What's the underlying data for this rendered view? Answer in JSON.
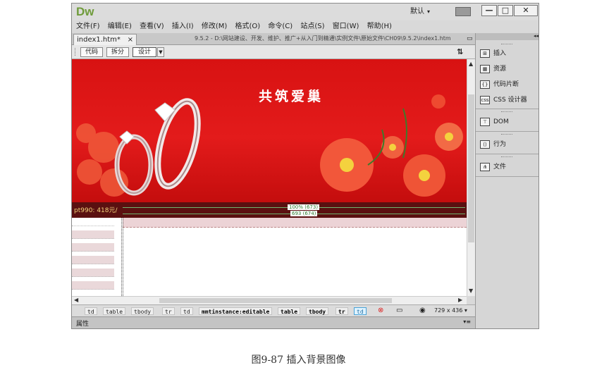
{
  "app": {
    "logo": "Dw",
    "workspace": "默认",
    "workspace_arrow": "▾"
  },
  "window_controls": {
    "minimize": "—",
    "maximize": "□",
    "close": "✕"
  },
  "menu": [
    "文件(F)",
    "编辑(E)",
    "查看(V)",
    "插入(I)",
    "修改(M)",
    "格式(O)",
    "命令(C)",
    "站点(S)",
    "窗口(W)",
    "帮助(H)"
  ],
  "document": {
    "tab": "index1.htm*",
    "tab_close": "×",
    "path": "9.5.2 - D:\\网站建设、开发、维护、推广+从入门到精通\\实例文件\\原始文件\\CH09\\9.5.2\\index1.htm"
  },
  "view_buttons": {
    "code": "代码",
    "split": "拆分",
    "design": "设计"
  },
  "canvas": {
    "banner_title": "共筑爱巢",
    "price_text": "pt990: 418元/",
    "guide_top": "100% (673)",
    "guide_bottom": "693 (674)"
  },
  "tag_selector": [
    "td",
    "table",
    "tbody",
    "tr",
    "td",
    "mmtinstance:editable",
    "table",
    "tbody",
    "tr",
    "td"
  ],
  "status": {
    "dimensions": "729 x 436"
  },
  "properties": {
    "label": "属性"
  },
  "panel": {
    "groups": [
      [
        "插入",
        "资源",
        "代码片断",
        "CSS 设计器"
      ],
      [
        "DOM"
      ],
      [
        "行为"
      ],
      [
        "文件"
      ]
    ]
  },
  "caption": "图9-87  插入背景图像",
  "colors": {
    "banner": "#e31b1b",
    "accent": "#6f9b3b",
    "guide": "#6fb36f"
  }
}
